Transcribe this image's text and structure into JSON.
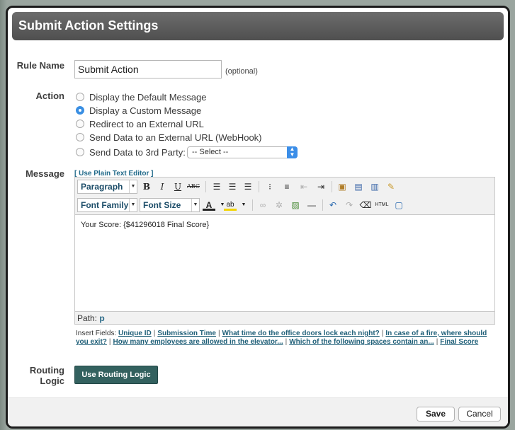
{
  "dialog": {
    "title": "Submit Action Settings"
  },
  "rule_name": {
    "label": "Rule Name",
    "value": "Submit Action",
    "hint": "(optional)"
  },
  "action": {
    "label": "Action",
    "options": [
      {
        "label": "Display the Default Message",
        "selected": false
      },
      {
        "label": "Display a Custom Message",
        "selected": true
      },
      {
        "label": "Redirect to an External URL",
        "selected": false
      },
      {
        "label": "Send Data to an External URL (WebHook)",
        "selected": false
      },
      {
        "label": "Send Data to 3rd Party:",
        "selected": false
      }
    ],
    "third_party_select": "-- Select --"
  },
  "message": {
    "label": "Message",
    "plain_text_link": "[ Use Plain Text Editor ]",
    "toolbar": {
      "paragraph": "Paragraph",
      "font_family": "Font Family",
      "font_size": "Font Size",
      "bold": "B",
      "italic": "I",
      "underline": "U",
      "strike": "ABC",
      "html": "HTML"
    },
    "content": "Your Score: {$41296018 Final Score}",
    "path_label": "Path:",
    "path_value": "p"
  },
  "insert_fields": {
    "label": "Insert Fields:",
    "fields": [
      "Unique ID",
      "Submission Time",
      "What time do the office doors lock each night?",
      "In case of a fire, where should you exit?",
      "How many employees are allowed in the elevator...",
      "Which of the following spaces contain an...",
      "Final Score"
    ]
  },
  "routing": {
    "label": "Routing Logic",
    "button": "Use Routing Logic"
  },
  "footer": {
    "save": "Save",
    "cancel": "Cancel"
  }
}
